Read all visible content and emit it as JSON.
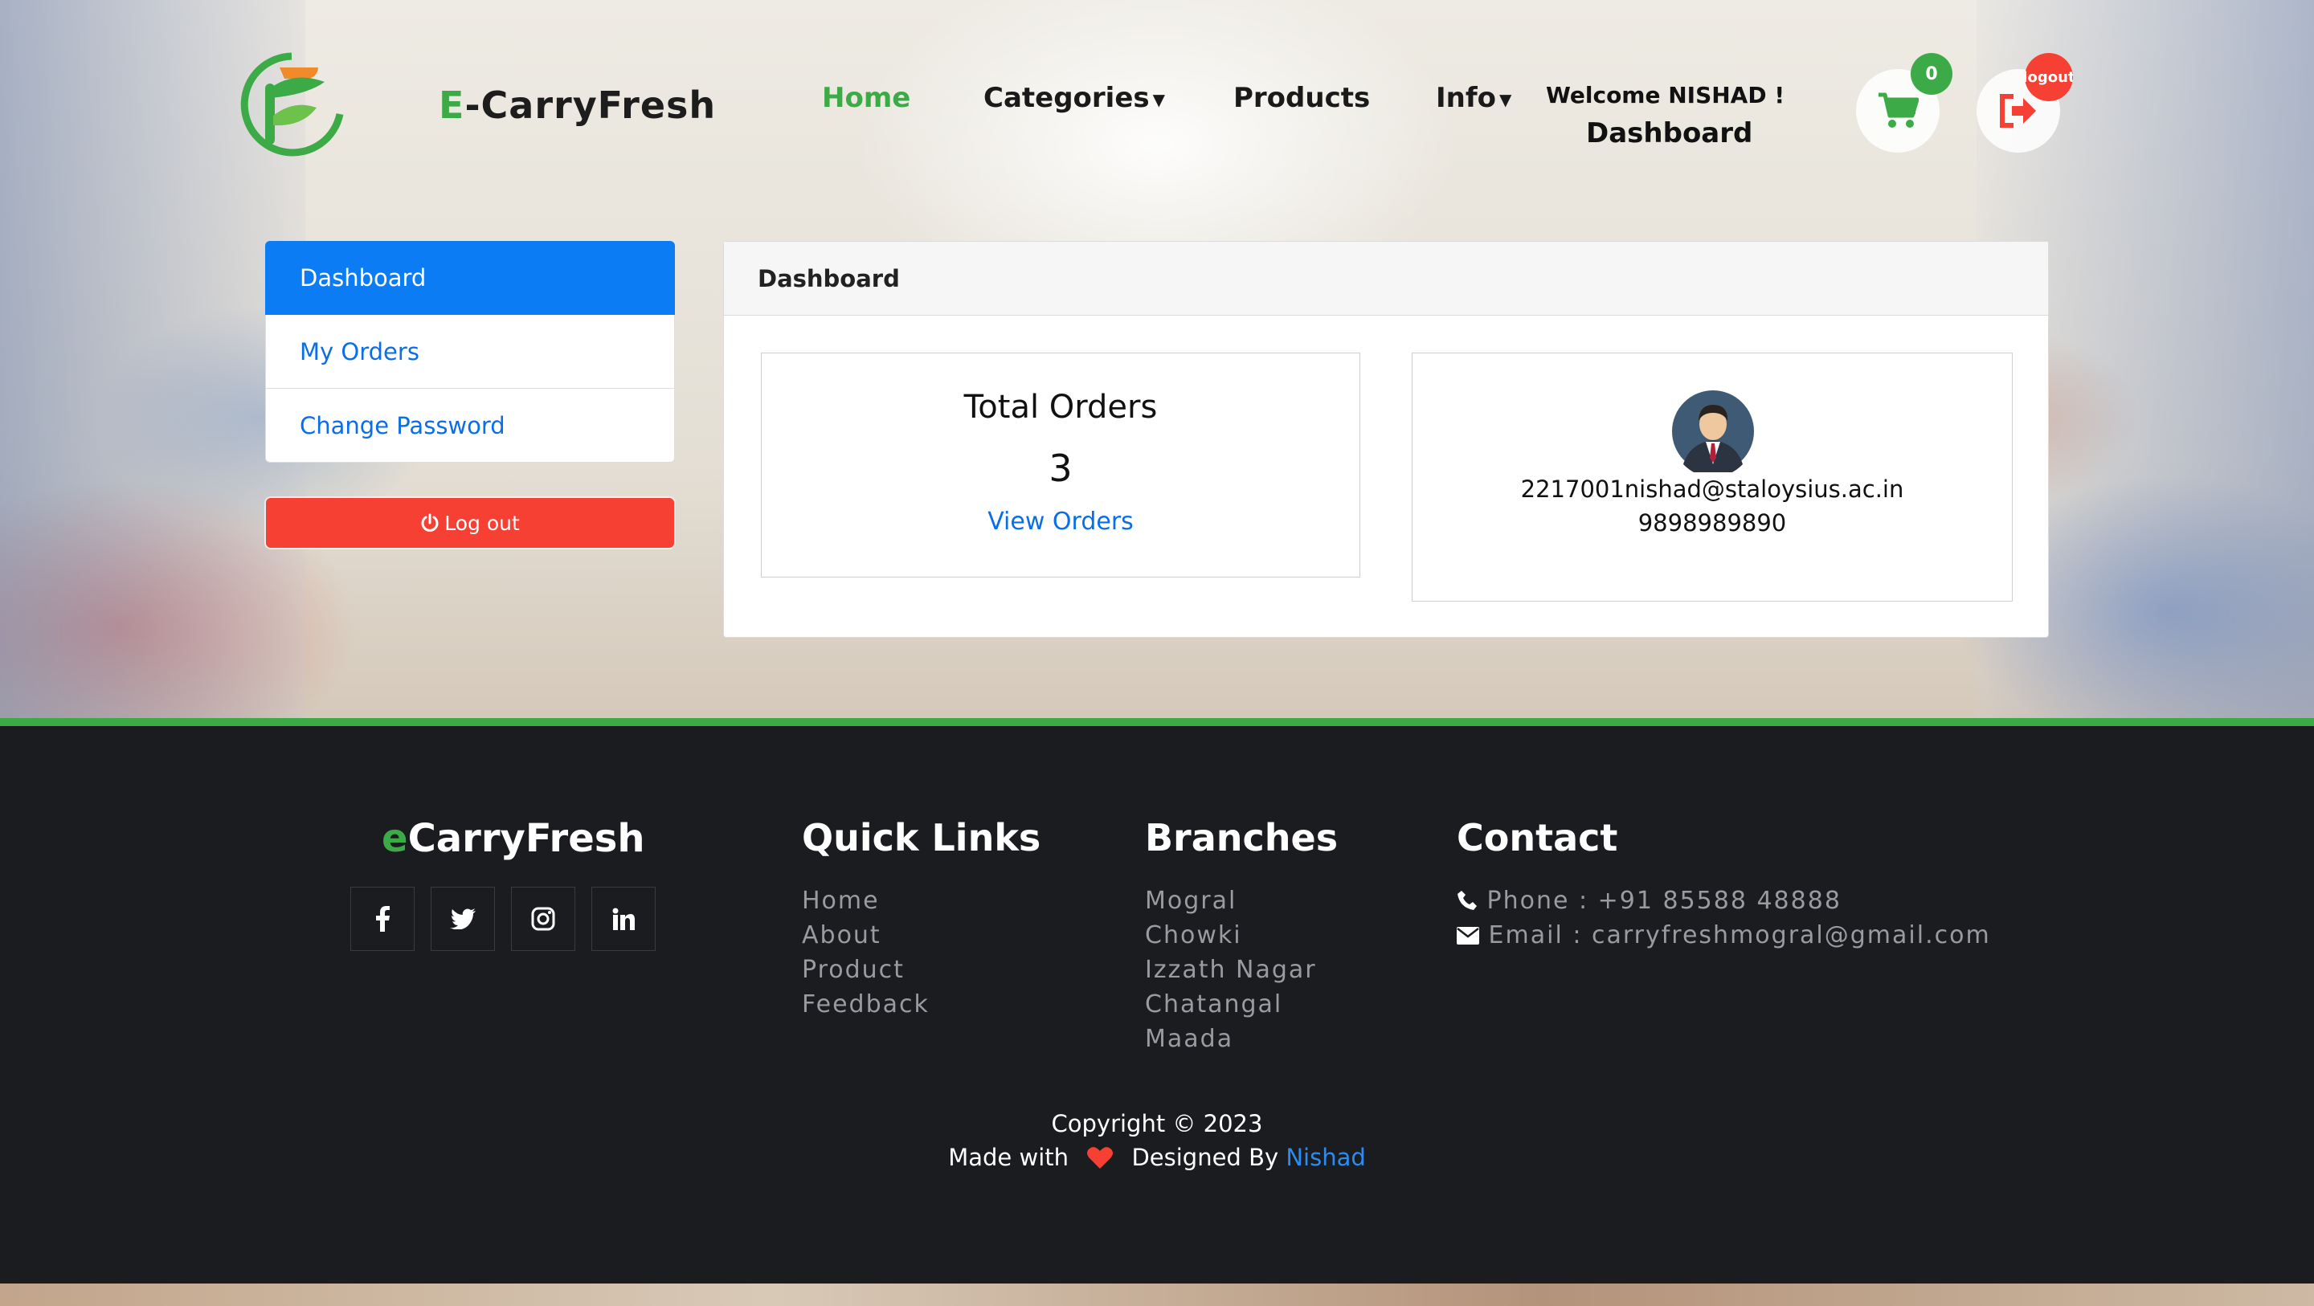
{
  "header": {
    "brand_prefix": "E",
    "brand_rest": "-CarryFresh",
    "nav": {
      "home": "Home",
      "categories": "Categories",
      "products": "Products",
      "info": "Info"
    },
    "welcome": "Welcome NISHAD !",
    "dashboard_link": "Dashboard",
    "cart_count": "0",
    "logout_badge": "logout"
  },
  "sidebar": {
    "items": [
      "Dashboard",
      "My Orders",
      "Change Password"
    ],
    "logout_label": "Log out"
  },
  "panel": {
    "title": "Dashboard",
    "orders_card": {
      "title": "Total Orders",
      "count": "3",
      "link": "View Orders"
    },
    "profile_card": {
      "email": "2217001nishad@staloysius.ac.in",
      "phone": "9898989890"
    }
  },
  "footer": {
    "brand_prefix": "e",
    "brand_rest": "CarryFresh",
    "social_icons": [
      "facebook-icon",
      "twitter-icon",
      "instagram-icon",
      "linkedin-icon"
    ],
    "quick_links": {
      "title": "Quick Links",
      "items": [
        "Home",
        "About",
        "Product",
        "Feedback"
      ]
    },
    "branches": {
      "title": "Branches",
      "items": [
        "Mogral",
        "Chowki",
        "Izzath Nagar",
        "Chatangal",
        "Maada"
      ]
    },
    "contact": {
      "title": "Contact",
      "phone": "Phone : +91 85588 48888",
      "email": "Email : carryfreshmogral@gmail.com"
    },
    "copyright": "Copyright © 2023",
    "made_with": "Made with",
    "designed_by": "Designed By",
    "designer": "Nishad"
  },
  "colors": {
    "accent_green": "#3cab47",
    "primary_blue": "#0b7cf4",
    "danger_red": "#f54033",
    "footer_bg": "#1b1c1f"
  }
}
